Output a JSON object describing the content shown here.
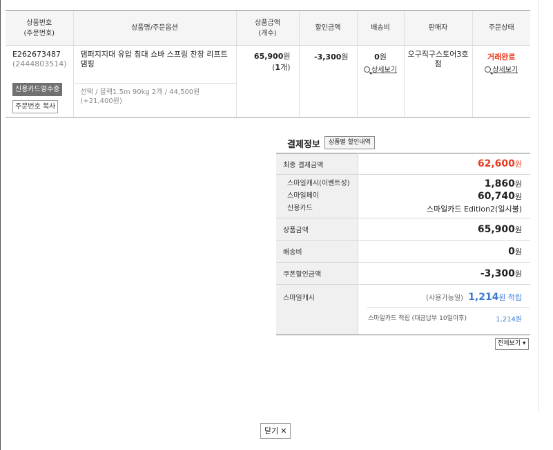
{
  "table": {
    "headers": {
      "order_no": "상품번호",
      "order_no_sub": "(주문번호)",
      "product": "상품명/주문옵션",
      "price": "상품금액",
      "price_sub": "(개수)",
      "discount": "할인금액",
      "shipping": "배송비",
      "seller": "판매자",
      "status": "주문상태"
    },
    "row": {
      "product_no": "E262673487",
      "order_no": "(2444803514)",
      "card_receipt_button": "신용카드영수증",
      "copy_order_button": "주문번호 복사",
      "product_name": "댐퍼지지대 유압 침대 쇼바 스프링 찬장 리프트 댐핑",
      "option": "선택 / 블랙1.5m 90kg 2개 / 44,500원(+21,400원)",
      "price": "65,900",
      "won": "원",
      "qty_prefix": "(",
      "qty": "1",
      "qty_suffix": "개)",
      "discount": "-3,300",
      "shipping": "0",
      "detail_link": "상세보기",
      "seller": "오구직구스토어3호점",
      "status": "거래완료",
      "status_detail_link": "상세보기"
    }
  },
  "payment": {
    "title": "결제정보",
    "discount_detail_button": "상품별 할인내역",
    "final_label": "최종 결제금액",
    "final_value": "62,600",
    "won": "원",
    "methods": [
      {
        "label": "스마일캐시(이벤트성)",
        "value": "1,860",
        "won": "원"
      },
      {
        "label": "스마일페이",
        "value": "60,740",
        "won": "원"
      },
      {
        "label": "신용카드",
        "value": "스마일카드 Edition2(일시불)"
      }
    ],
    "product_amount_label": "상품금액",
    "product_amount_value": "65,900",
    "shipping_label": "배송비",
    "shipping_value": "0",
    "coupon_label": "쿠폰할인금액",
    "coupon_value": "-3,300",
    "smilecash_label": "스마일캐시",
    "smilecash_available": "(사용가능일)",
    "smilecash_amount": "1,214",
    "smilecash_won": "원",
    "smilecash_earn": "적립",
    "smilecard_label": "스마일카드 적립 (대금납부 10일이후)",
    "smilecard_value": "1,214원"
  },
  "view_all_select": "전체보기",
  "close_button": "닫기"
}
